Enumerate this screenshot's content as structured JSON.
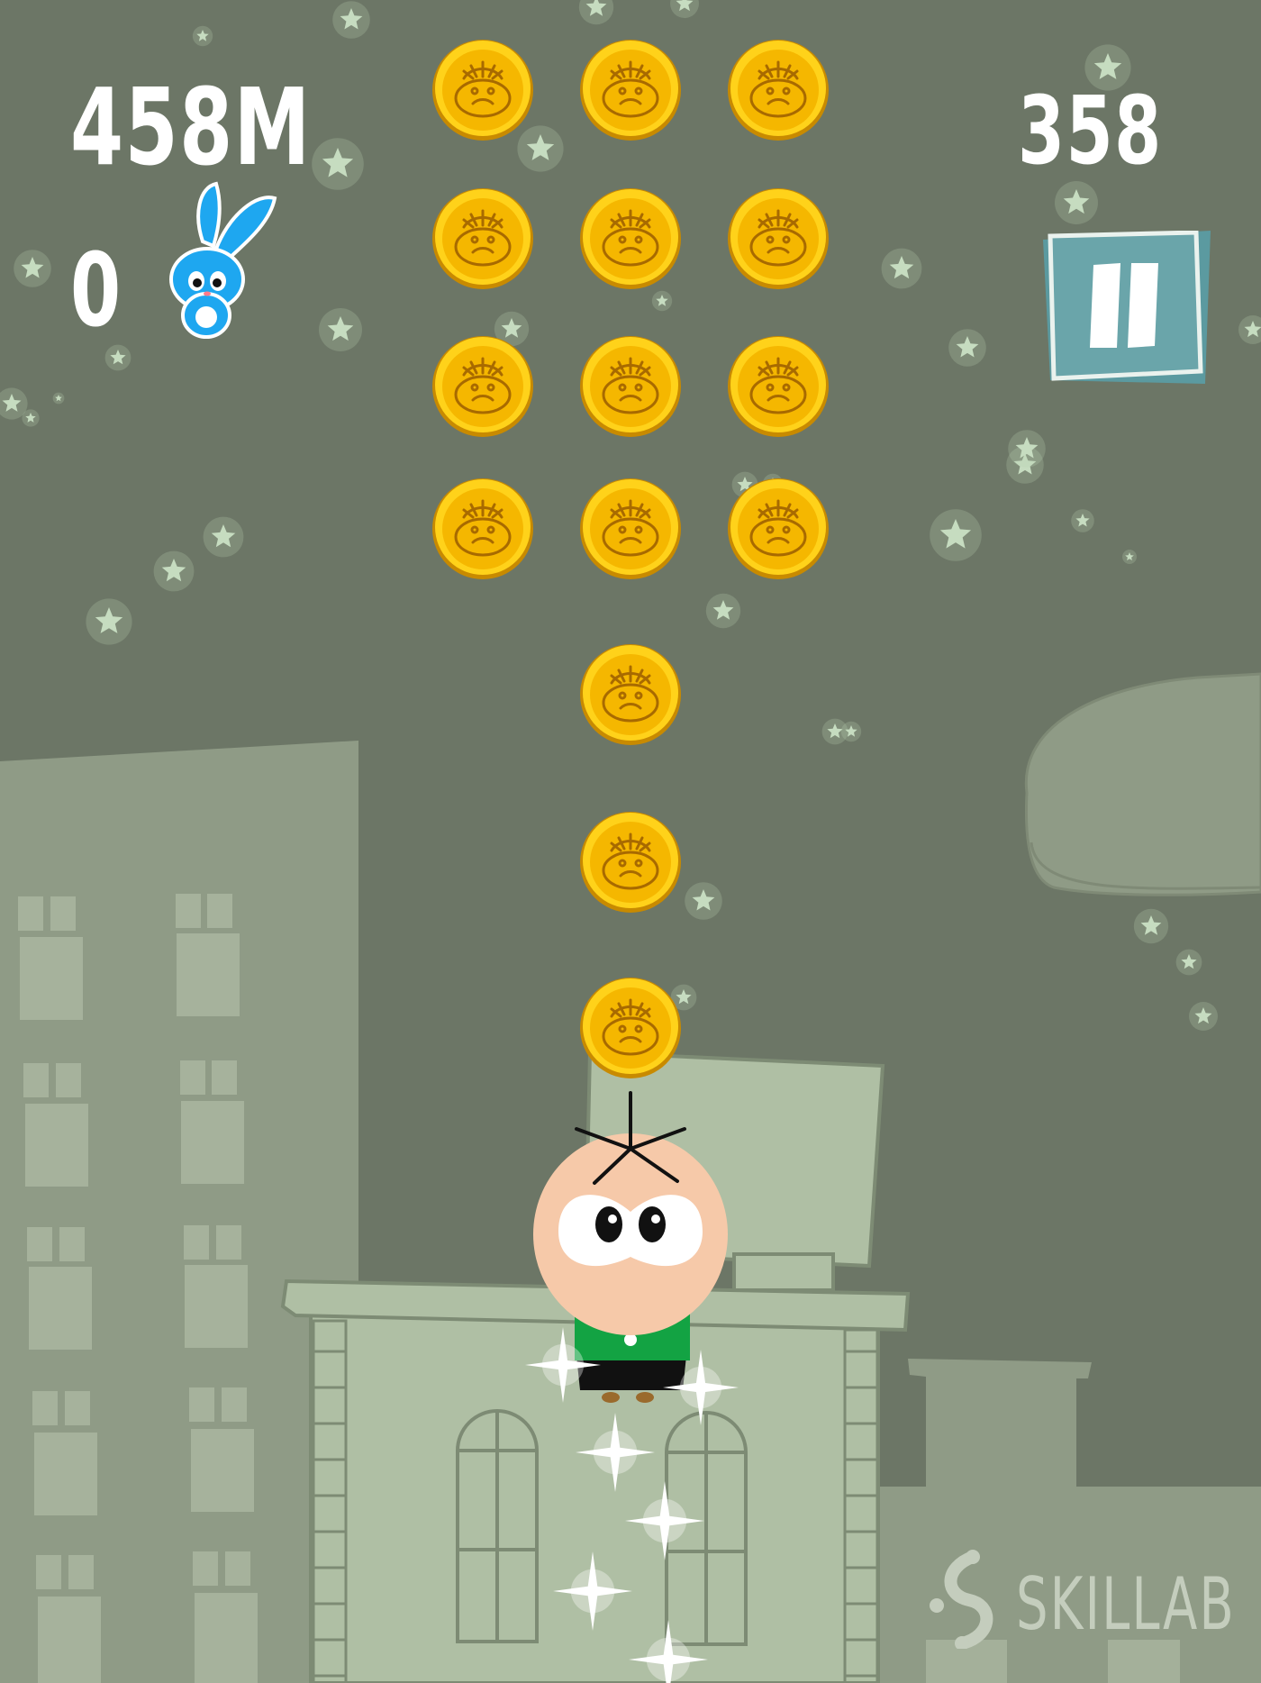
{
  "hud": {
    "distance": "458M",
    "bunny_count": "0",
    "coin_count": "358",
    "bunny_icon": "blue-bunny-icon",
    "pause_icon": "pause-icon"
  },
  "watermark": {
    "text": "SKILLAB",
    "icon": "skillab-logo-icon"
  },
  "colors": {
    "background": "#6c7666",
    "building": "#a4b49a",
    "coin": "#f5b700",
    "pause_button": "#6aa3a8",
    "bunny": "#1ea7f0",
    "shirt": "#12a040"
  },
  "coins": {
    "count": 15,
    "icon": "face-coin-icon"
  },
  "character": {
    "name": "player-character"
  }
}
